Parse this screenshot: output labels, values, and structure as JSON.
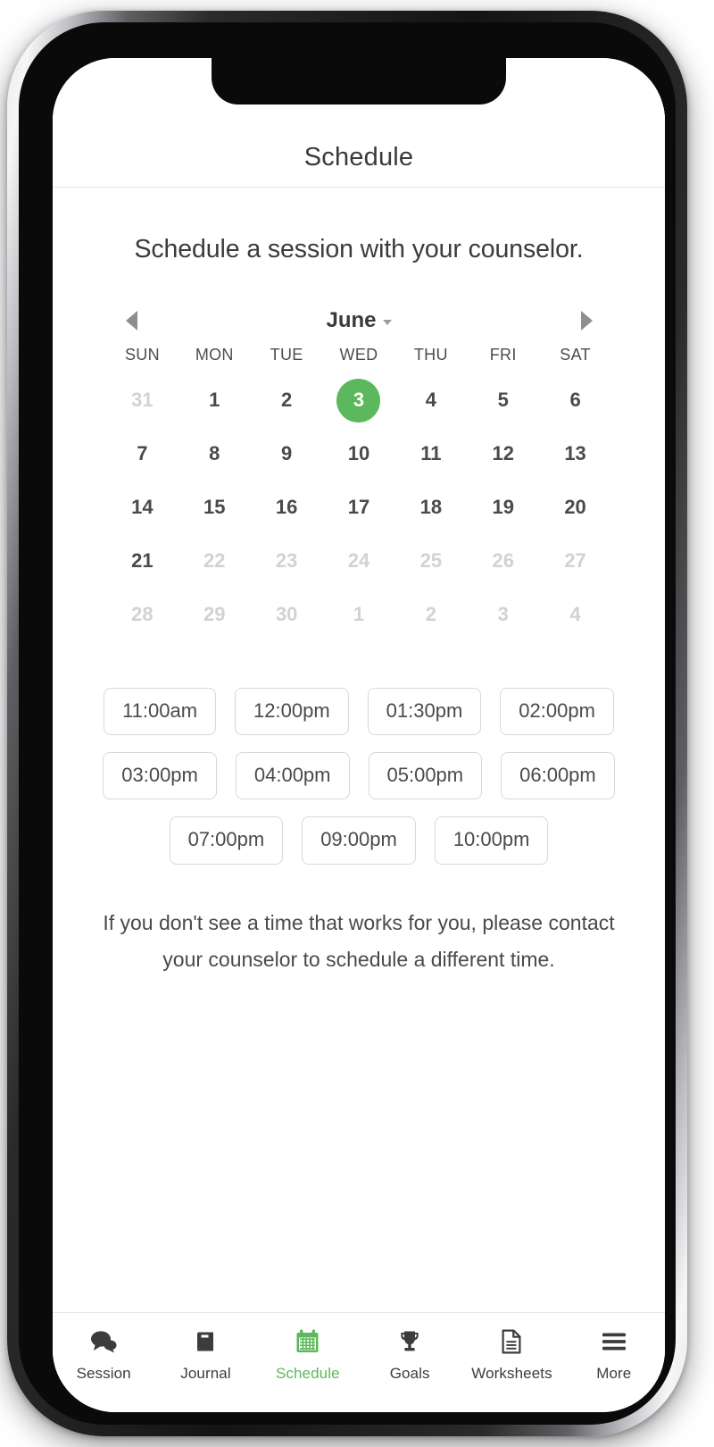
{
  "colors": {
    "accent_green": "#5cb85c",
    "text_primary": "#4a4a4a",
    "text_muted": "#d2d2d2",
    "border": "#d8d8d8"
  },
  "nav": {
    "title": "Schedule"
  },
  "main": {
    "headline": "Schedule a session with your counselor.",
    "note_line_1": "If you don't see a time that works for you, please",
    "note_line_2": "contact your counselor to schedule a different time."
  },
  "calendar": {
    "month_label": "June",
    "prev_icon": "triangle-left-icon",
    "next_icon": "triangle-right-icon",
    "dropdown_icon": "caret-down-icon",
    "weekdays": [
      "SUN",
      "MON",
      "TUE",
      "WED",
      "THU",
      "FRI",
      "SAT"
    ],
    "selected_day": 3,
    "days": [
      {
        "label": "31",
        "state": "muted"
      },
      {
        "label": "1",
        "state": "enabled"
      },
      {
        "label": "2",
        "state": "enabled"
      },
      {
        "label": "3",
        "state": "selected"
      },
      {
        "label": "4",
        "state": "enabled"
      },
      {
        "label": "5",
        "state": "enabled"
      },
      {
        "label": "6",
        "state": "enabled"
      },
      {
        "label": "7",
        "state": "enabled"
      },
      {
        "label": "8",
        "state": "enabled"
      },
      {
        "label": "9",
        "state": "enabled"
      },
      {
        "label": "10",
        "state": "enabled"
      },
      {
        "label": "11",
        "state": "enabled"
      },
      {
        "label": "12",
        "state": "enabled"
      },
      {
        "label": "13",
        "state": "enabled"
      },
      {
        "label": "14",
        "state": "enabled"
      },
      {
        "label": "15",
        "state": "enabled"
      },
      {
        "label": "16",
        "state": "enabled"
      },
      {
        "label": "17",
        "state": "enabled"
      },
      {
        "label": "18",
        "state": "enabled"
      },
      {
        "label": "19",
        "state": "enabled"
      },
      {
        "label": "20",
        "state": "enabled"
      },
      {
        "label": "21",
        "state": "enabled"
      },
      {
        "label": "22",
        "state": "muted"
      },
      {
        "label": "23",
        "state": "muted"
      },
      {
        "label": "24",
        "state": "muted"
      },
      {
        "label": "25",
        "state": "muted"
      },
      {
        "label": "26",
        "state": "muted"
      },
      {
        "label": "27",
        "state": "muted"
      },
      {
        "label": "28",
        "state": "muted"
      },
      {
        "label": "29",
        "state": "muted"
      },
      {
        "label": "30",
        "state": "muted"
      },
      {
        "label": "1",
        "state": "muted"
      },
      {
        "label": "2",
        "state": "muted"
      },
      {
        "label": "3",
        "state": "muted"
      },
      {
        "label": "4",
        "state": "muted"
      }
    ]
  },
  "time_slots": [
    "11:00am",
    "12:00pm",
    "01:30pm",
    "02:00pm",
    "03:00pm",
    "04:00pm",
    "05:00pm",
    "06:00pm",
    "07:00pm",
    "09:00pm",
    "10:00pm"
  ],
  "tab_bar": {
    "active_index": 2,
    "tabs": [
      {
        "label": "Session",
        "icon": "chat-bubbles-icon"
      },
      {
        "label": "Journal",
        "icon": "book-icon"
      },
      {
        "label": "Schedule",
        "icon": "calendar-icon"
      },
      {
        "label": "Goals",
        "icon": "trophy-icon"
      },
      {
        "label": "Worksheets",
        "icon": "document-icon"
      },
      {
        "label": "More",
        "icon": "hamburger-menu-icon"
      }
    ]
  }
}
